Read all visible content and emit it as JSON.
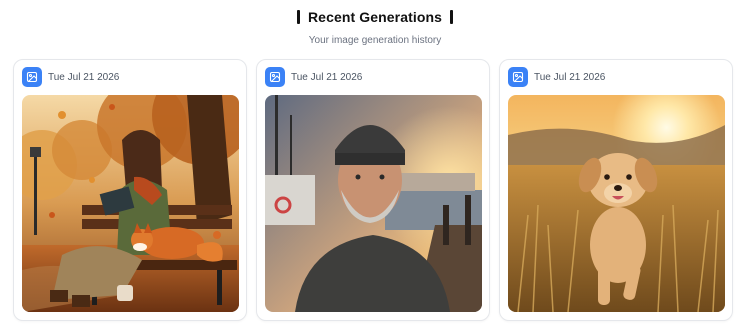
{
  "header": {
    "title": "Recent Generations",
    "subtitle": "Your image generation history"
  },
  "cards": [
    {
      "date": "Tue Jul 21 2026",
      "icon": "image-icon",
      "image": "autumn-woman-reading-with-fox"
    },
    {
      "date": "Tue Jul 21 2026",
      "icon": "image-icon",
      "image": "old-fisherman-on-dock"
    },
    {
      "date": "Tue Jul 21 2026",
      "icon": "image-icon",
      "image": "golden-retriever-puppy-in-field"
    }
  ],
  "colors": {
    "accent": "#3b82f6",
    "border": "#e5e7eb",
    "muted": "#6b7280"
  }
}
